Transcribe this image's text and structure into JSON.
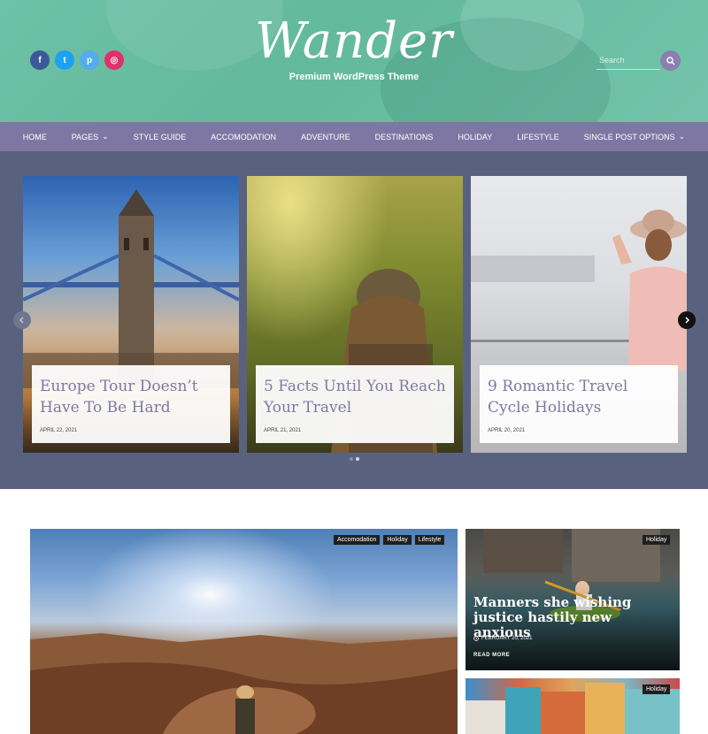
{
  "header": {
    "logo": "Wander",
    "tagline": "Premium WordPress Theme",
    "search_placeholder": "Search",
    "socials": [
      {
        "name": "facebook-icon",
        "glyph": "f",
        "color": "#3b5998"
      },
      {
        "name": "twitter-icon",
        "glyph": "t",
        "color": "#1da1f2"
      },
      {
        "name": "pinterest-icon",
        "glyph": "p",
        "color": "#55acee"
      },
      {
        "name": "instagram-icon",
        "glyph": "◎",
        "color": "#e1306c"
      }
    ]
  },
  "nav": {
    "items": [
      {
        "label": "HOME",
        "dropdown": false
      },
      {
        "label": "PAGES",
        "dropdown": true
      },
      {
        "label": "STYLE GUIDE",
        "dropdown": false
      },
      {
        "label": "ACCOMODATION",
        "dropdown": false
      },
      {
        "label": "ADVENTURE",
        "dropdown": false
      },
      {
        "label": "DESTINATIONS",
        "dropdown": false
      },
      {
        "label": "HOLIDAY",
        "dropdown": false
      },
      {
        "label": "LIFESTYLE",
        "dropdown": false
      },
      {
        "label": "SINGLE POST OPTIONS",
        "dropdown": true
      }
    ]
  },
  "slider": {
    "slides": [
      {
        "title": "Europe Tour Doesn’t Have To Be Hard",
        "date": "APRIL 22, 2021"
      },
      {
        "title": "5 Facts Until You Reach Your Travel",
        "date": "APRIL 21, 2021"
      },
      {
        "title": "9 Romantic Travel Cycle Holidays",
        "date": "APRIL 20, 2021"
      }
    ]
  },
  "featured": {
    "big_post": {
      "tags": [
        "Accomodation",
        "Holiday",
        "Lifestyle"
      ]
    },
    "side_posts": [
      {
        "tag": "Holiday",
        "title": "Manners she wishing justice hastily new anxious",
        "date": "FEBRUARY 20, 2021",
        "read_more": "READ MORE"
      },
      {
        "tag": "Holiday"
      }
    ]
  }
}
